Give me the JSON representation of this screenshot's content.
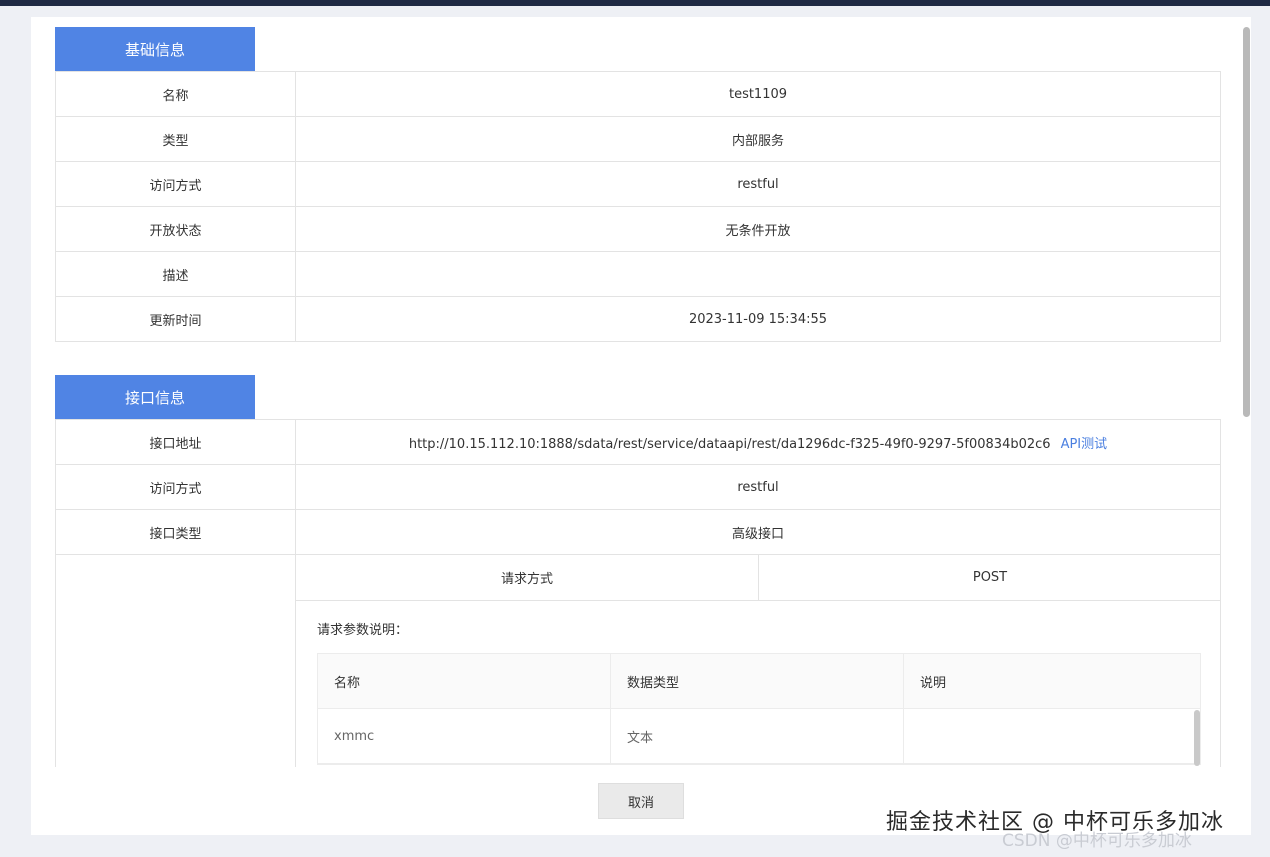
{
  "basic": {
    "tab_label": "基础信息",
    "rows": [
      {
        "key": "名称",
        "value": "test1109"
      },
      {
        "key": "类型",
        "value": "内部服务"
      },
      {
        "key": "访问方式",
        "value": "restful"
      },
      {
        "key": "开放状态",
        "value": "无条件开放"
      },
      {
        "key": "描述",
        "value": ""
      },
      {
        "key": "更新时间",
        "value": "2023-11-09 15:34:55"
      }
    ]
  },
  "api": {
    "tab_label": "接口信息",
    "address_key": "接口地址",
    "address_value": "http://10.15.112.10:1888/sdata/rest/service/dataapi/rest/da1296dc-f325-49f0-9297-5f00834b02c6",
    "test_link": "API测试",
    "access_key": "访问方式",
    "access_value": "restful",
    "type_key": "接口类型",
    "type_value": "高级接口",
    "method_label": "请求方式",
    "method_value": "POST",
    "params_title": "请求参数说明：",
    "params_headers": [
      "名称",
      "数据类型",
      "说明"
    ],
    "params_rows": [
      {
        "name": "xmmc",
        "type": "文本",
        "desc": ""
      }
    ]
  },
  "footer": {
    "cancel_label": "取消"
  },
  "watermark": {
    "main": "掘金技术社区 @ 中杯可乐多加冰",
    "sub": "CSDN @中杯可乐多加冰"
  },
  "colors": {
    "accent": "#5084e4",
    "link": "#4a7fe0",
    "topbar": "#1f2a44"
  }
}
